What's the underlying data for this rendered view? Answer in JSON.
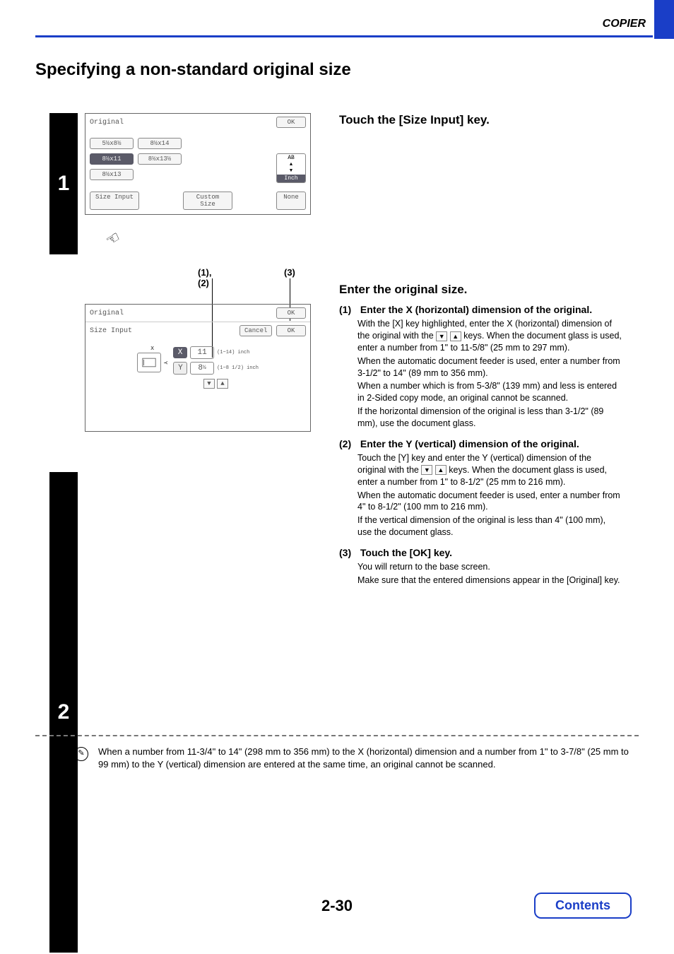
{
  "header": {
    "section": "COPIER"
  },
  "page_title": "Specifying a non-standard original size",
  "step1": {
    "number": "1",
    "instruction": "Touch the [Size Input] key.",
    "panel": {
      "title": "Original",
      "ok": "OK",
      "sizes": [
        "5½x8½",
        "8½x14",
        "8½x11",
        "8½x13½",
        "8½x13"
      ],
      "unit_top": "AB",
      "unit_bottom": "Inch",
      "size_input": "Size Input",
      "custom_size": "Custom Size",
      "none": "None"
    }
  },
  "step2": {
    "number": "2",
    "instruction": "Enter the original size.",
    "callouts": {
      "left": "(1), (2)",
      "right": "(3)"
    },
    "panel": {
      "title": "Original",
      "ok_top": "OK",
      "subtitle": "Size Input",
      "cancel": "Cancel",
      "ok_sub": "OK",
      "x_label": "X",
      "x_val": "11",
      "x_range": "(1~14) inch",
      "y_label": "Y",
      "y_val": "8",
      "y_frac": "½",
      "y_range": "(1~8 1/2) inch"
    },
    "subs": {
      "s1_num": "(1)",
      "s1_title": "Enter the X (horizontal) dimension of the original.",
      "s1_body_a": "With the [X] key highlighted, enter the X (horizontal) dimension of the original with the ",
      "s1_body_b": " keys. When the document glass is used, enter a number from 1\" to 11-5/8\" (25 mm to 297 mm).",
      "s1_body_c": "When the automatic document feeder is used, enter a number from  3-1/2\" to 14\" (89 mm to 356 mm).",
      "s1_body_d": "When a number which is from 5-3/8\" (139 mm) and less is entered in 2-Sided copy mode, an original cannot be scanned.",
      "s1_body_e": "If the horizontal dimension of the original is less than 3-1/2\" (89 mm), use the document glass.",
      "s2_num": "(2)",
      "s2_title": "Enter the Y (vertical) dimension of the original.",
      "s2_body_a": "Touch the [Y] key and enter the Y (vertical) dimension of the original with the ",
      "s2_body_b": " keys. When the document glass is used, enter a number from 1\" to 8-1/2\" (25 mm to 216 mm).",
      "s2_body_c": "When the automatic document feeder is used, enter a number from 4\" to 8-1/2\" (100 mm to 216 mm).",
      "s2_body_d": "If the vertical dimension of the original is less than 4\" (100 mm), use the document glass.",
      "s3_num": "(3)",
      "s3_title": "Touch the [OK] key.",
      "s3_body_a": "You will return to the base screen.",
      "s3_body_b": "Make sure that the entered dimensions appear in the [Original] key."
    }
  },
  "note": "When a number from 11-3/4\" to 14\" (298 mm to 356 mm) to the X (horizontal) dimension and a number from 1\" to 3-7/8\" (25 mm to 99 mm) to the Y (vertical) dimension are entered at the same time, an original cannot be scanned.",
  "page_number": "2-30",
  "contents": "Contents"
}
